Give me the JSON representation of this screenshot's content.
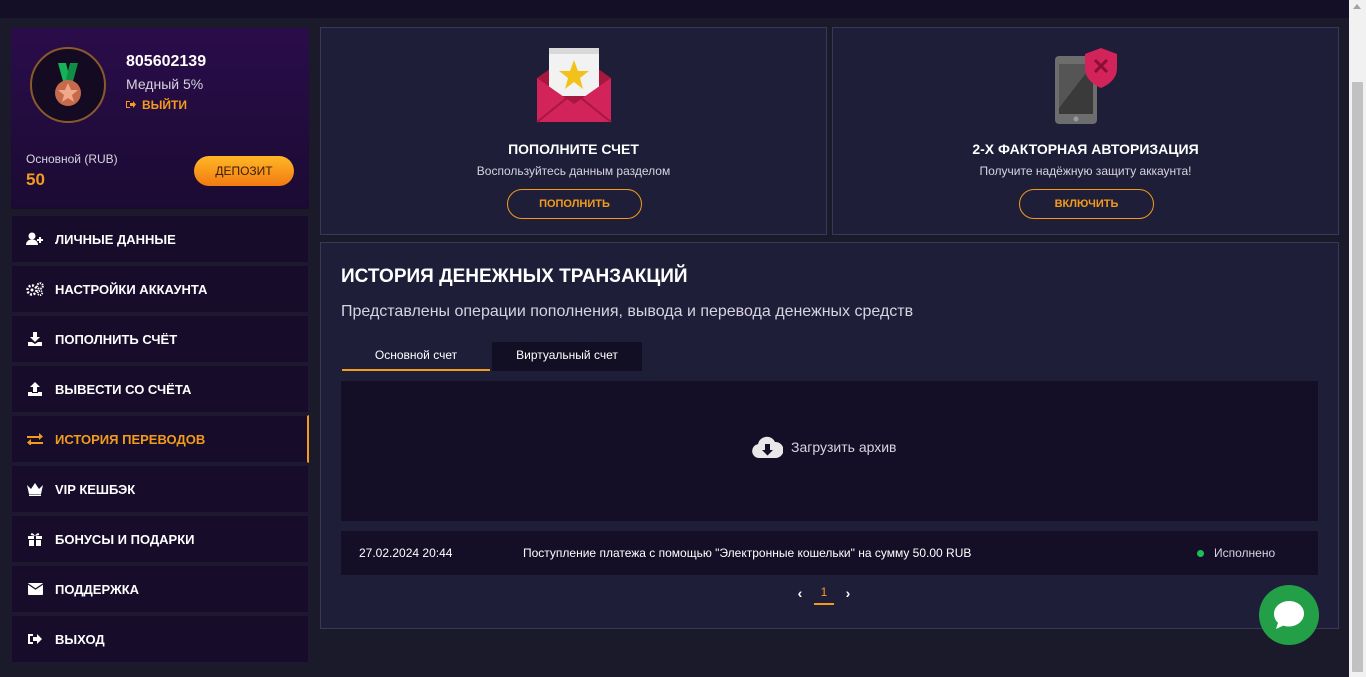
{
  "profile": {
    "user_id": "805602139",
    "rank": "Медный 5%",
    "logout_label": "ВЫЙТИ",
    "balance_label": "Основной (RUB)",
    "balance_value": "50",
    "deposit_label": "ДЕПОЗИТ"
  },
  "menu": {
    "items": [
      {
        "label": "ЛИЧНЫЕ ДАННЫЕ",
        "icon": "user-plus-icon"
      },
      {
        "label": "НАСТРОЙКИ АККАУНТА",
        "icon": "gears-icon"
      },
      {
        "label": "ПОПОЛНИТЬ СЧЁТ",
        "icon": "download-icon"
      },
      {
        "label": "ВЫВЕСТИ СО СЧЁТА",
        "icon": "upload-icon"
      },
      {
        "label": "ИСТОРИЯ ПЕРЕВОДОВ",
        "icon": "exchange-icon",
        "active": true
      },
      {
        "label": "VIP КЕШБЭК",
        "icon": "crown-icon"
      },
      {
        "label": "БОНУСЫ И ПОДАРКИ",
        "icon": "gift-icon"
      },
      {
        "label": "ПОДДЕРЖКА",
        "icon": "envelope-icon"
      },
      {
        "label": "ВЫХОД",
        "icon": "sign-out-icon"
      }
    ]
  },
  "cards": {
    "deposit": {
      "title": "ПОПОЛНИТЕ СЧЕТ",
      "subtitle": "Воспользуйтесь данным разделом",
      "button": "ПОПОЛНИТЬ"
    },
    "twofa": {
      "title": "2-Х ФАКТОРНАЯ АВТОРИЗАЦИЯ",
      "subtitle": "Получите надёжную защиту аккаунта!",
      "button": "ВКЛЮЧИТЬ"
    }
  },
  "history": {
    "title": "ИСТОРИЯ ДЕНЕЖНЫХ ТРАНЗАКЦИЙ",
    "subtitle": "Представлены операции пополнения, вывода и перевода денежных средств",
    "tabs": [
      "Основной счет",
      "Виртуальный счет"
    ],
    "archive_label": "Загрузить архив",
    "transactions": [
      {
        "date": "27.02.2024 20:44",
        "description": "Поступление платежа с помощью \"Электронные кошельки\" на сумму 50.00 RUB",
        "status": "Исполнено"
      }
    ],
    "current_page": "1"
  },
  "colors": {
    "accent": "#f39b1c",
    "success": "#19c05a",
    "panel": "#1f1e38",
    "chat": "#23a047"
  }
}
